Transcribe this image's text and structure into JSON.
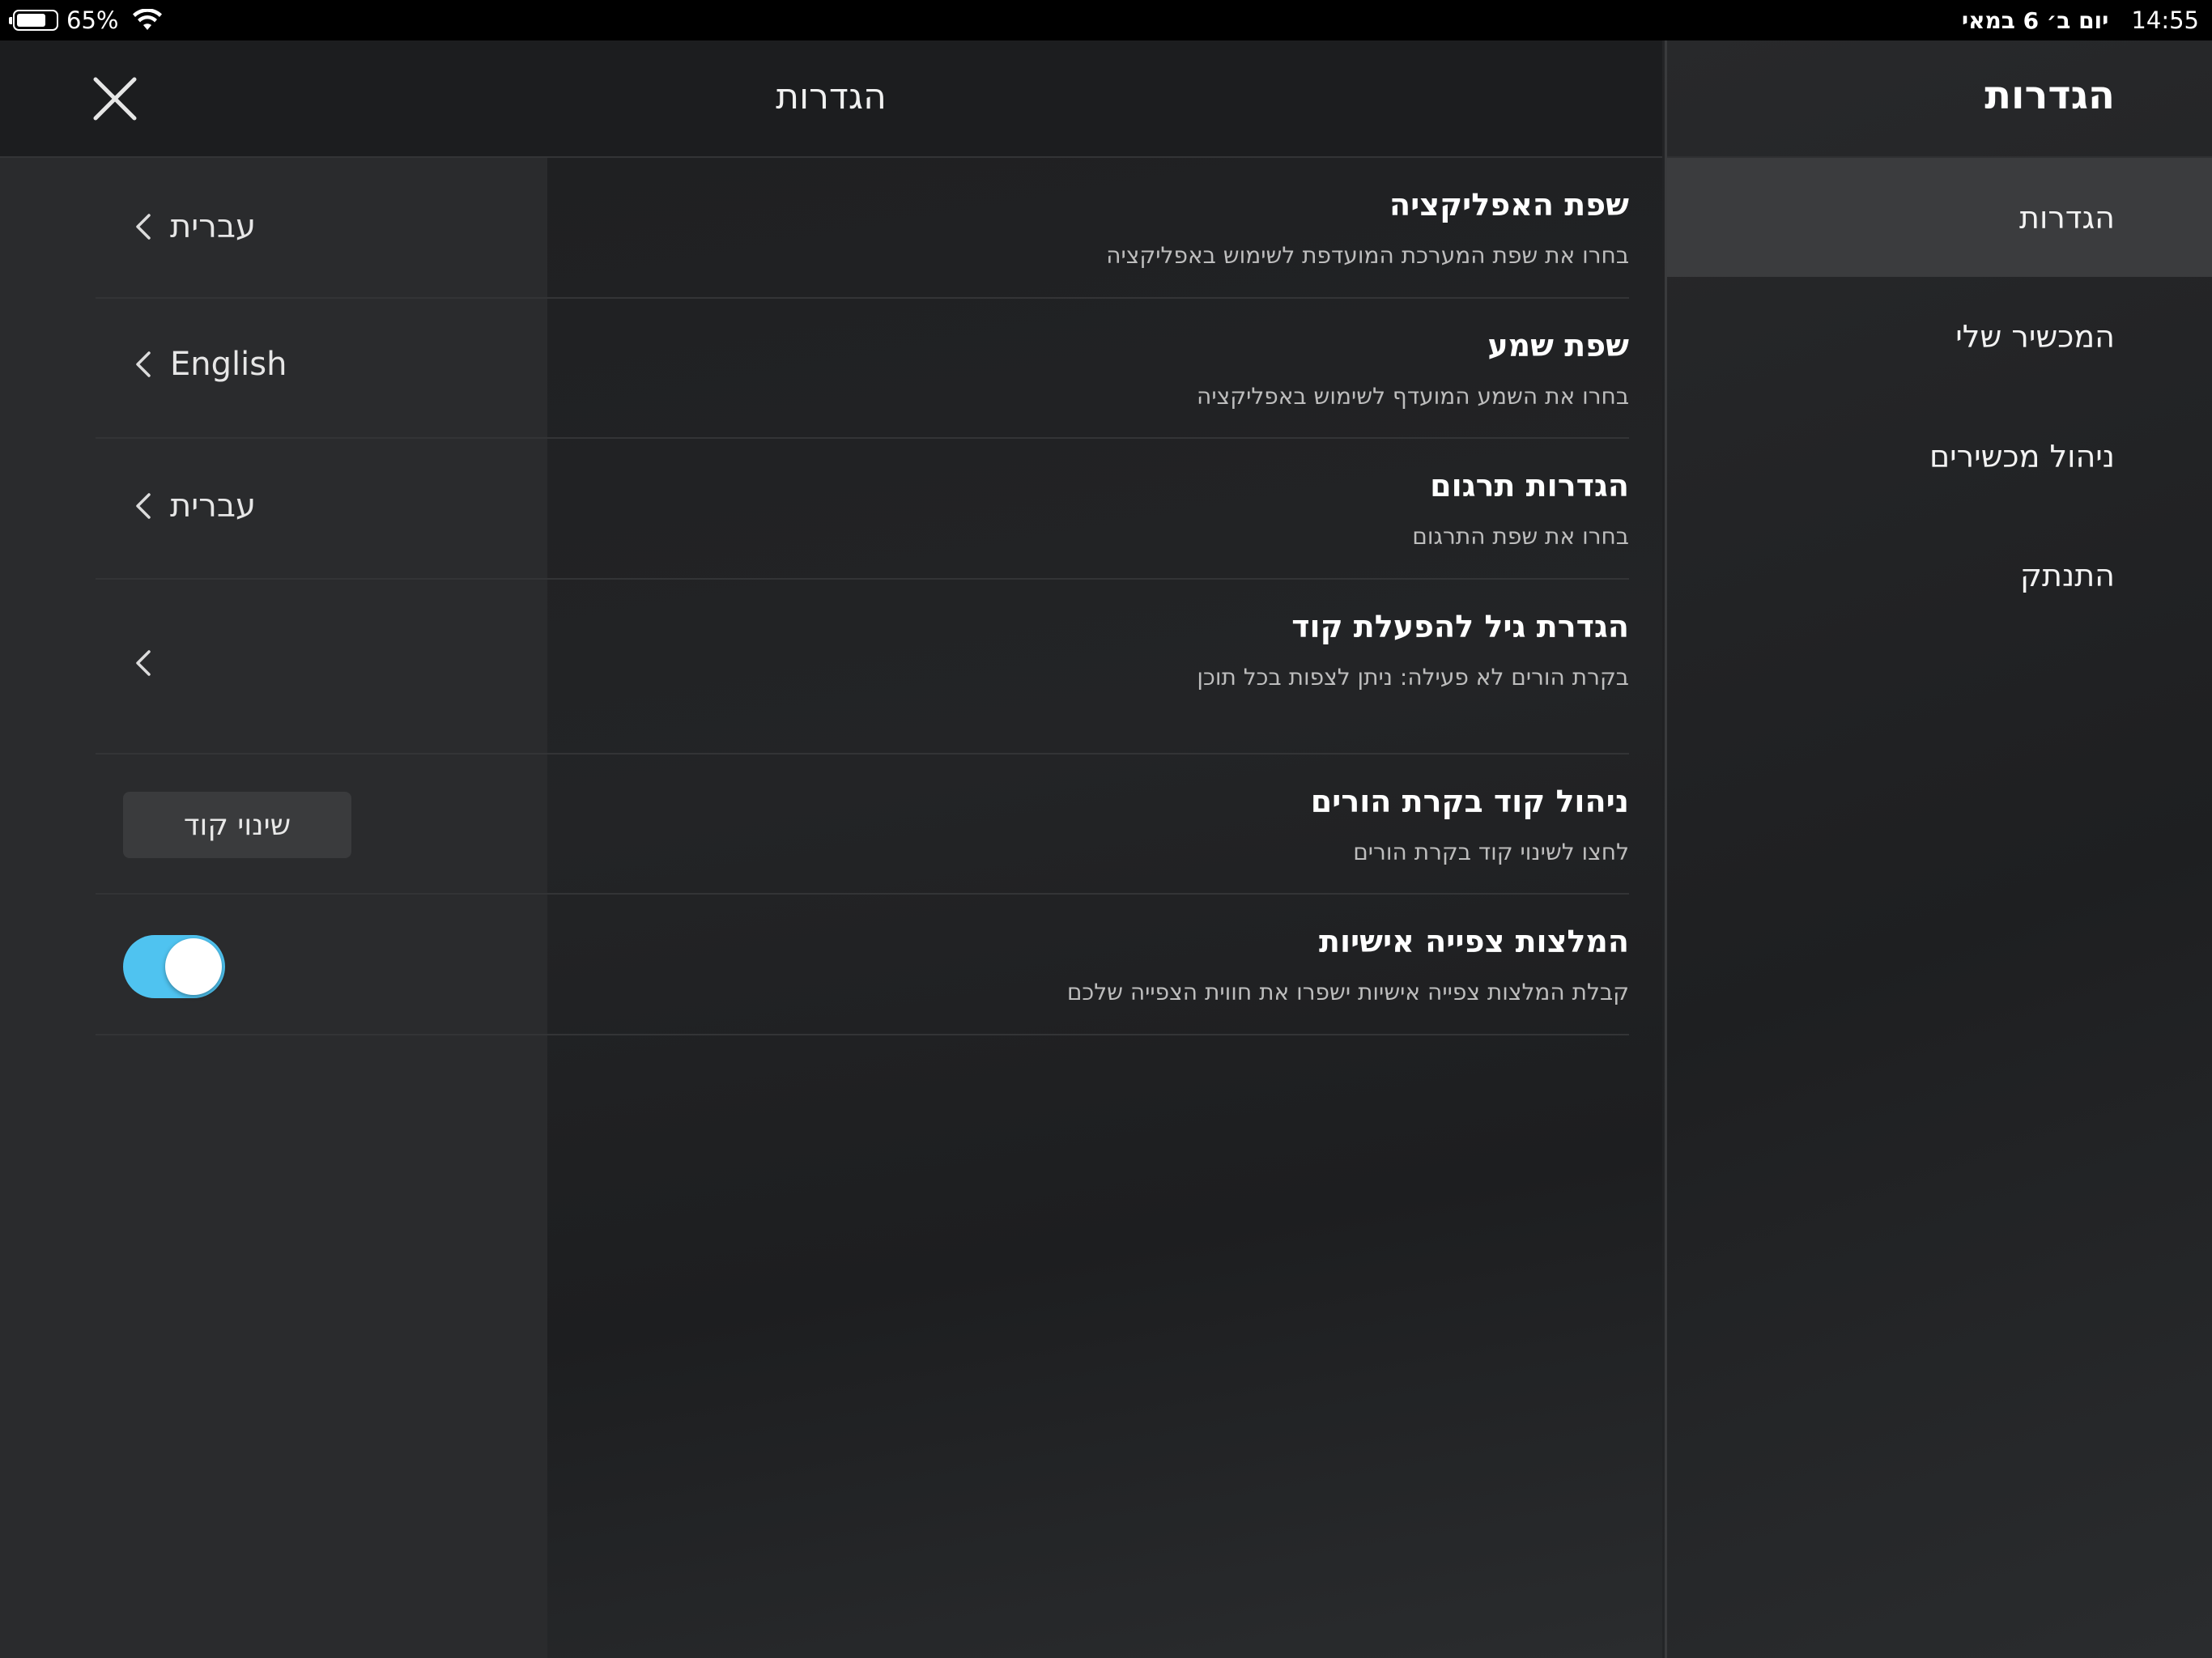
{
  "status_bar": {
    "battery_percent": "65%",
    "battery_level": 0.65,
    "time": "14:55",
    "date": "יום ב׳ 6 במאי"
  },
  "sidebar": {
    "title": "הגדרות",
    "items": [
      {
        "label": "הגדרות",
        "active": true
      },
      {
        "label": "המכשיר שלי",
        "active": false
      },
      {
        "label": "ניהול מכשירים",
        "active": false
      },
      {
        "label": "התנתק",
        "active": false
      }
    ]
  },
  "main": {
    "title": "הגדרות",
    "rows": [
      {
        "title": "שפת האפליקציה",
        "subtitle": "בחרו את שפת המערכת המועדפת לשימוש באפליקציה",
        "value": "עברית"
      },
      {
        "title": "שפת שמע",
        "subtitle": "בחרו את השמע המועדף  לשימוש באפליקציה",
        "value": "English"
      },
      {
        "title": "הגדרות תרגום",
        "subtitle": "בחרו את שפת התרגום",
        "value": "עברית"
      },
      {
        "title": "הגדרת גיל להפעלת קוד",
        "subtitle": "בקרת הורים לא פעילה: ניתן לצפות בכל תוכן",
        "value": ""
      },
      {
        "title": "ניהול קוד בקרת הורים",
        "subtitle": "לחצו לשינוי קוד בקרת הורים",
        "button_label": "שינוי קוד"
      },
      {
        "title": "המלצות צפייה אישיות",
        "subtitle": "קבלת המלצות צפייה אישיות ישפרו את חווית הצפייה שלכם",
        "toggle_on": true
      }
    ]
  },
  "colors": {
    "accent_toggle": "#4fc3f0",
    "background": "#1c1d1f",
    "sidebar_active": "#3b3c3e"
  }
}
